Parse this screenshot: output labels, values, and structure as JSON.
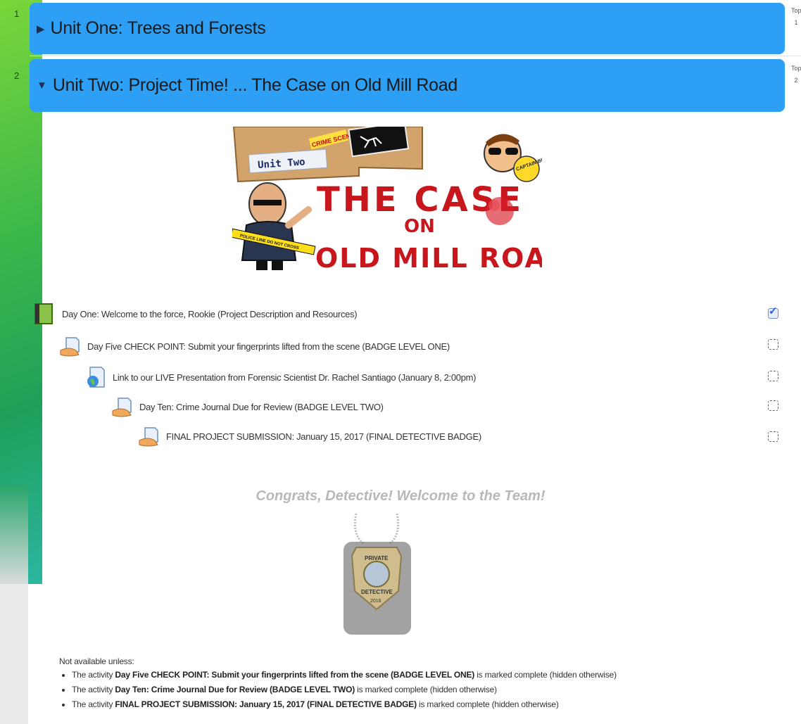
{
  "sections": [
    {
      "number": "1",
      "title": "Unit One: Trees and Forests",
      "expanded": false,
      "topic_label": "Top",
      "topic_num": "1"
    },
    {
      "number": "2",
      "title": "Unit Two: Project Time! ... The Case on Old Mill Road",
      "expanded": true,
      "topic_label": "Top",
      "topic_num": "2"
    }
  ],
  "banner": {
    "unit_label": "Unit Two",
    "crime_label": "CRIME SCENE",
    "title_line1": "THE CASE",
    "title_line2": "ON",
    "title_line3": "OLD MILL ROAD",
    "captain_label": "CAPTAIN BIGGS",
    "tape_label": "POLICE LINE DO NOT CROSS"
  },
  "activities": [
    {
      "label": "Day One: Welcome to the force, Rookie (Project Description and Resources)",
      "icon": "book-icon",
      "completed": true
    },
    {
      "label": "Day Five CHECK POINT: Submit your fingerprints lifted from the scene (BADGE LEVEL ONE)",
      "icon": "assignment-icon",
      "completed": false
    },
    {
      "label": "Link to our LIVE Presentation from Forensic Scientist Dr. Rachel Santiago (January 8, 2:00pm)",
      "icon": "url-globe-icon",
      "completed": false
    },
    {
      "label": "Day Ten: Crime Journal Due for Review (BADGE LEVEL TWO)",
      "icon": "assignment-icon",
      "completed": false
    },
    {
      "label": "FINAL PROJECT SUBMISSION: January 15, 2017 (FINAL DETECTIVE BADGE)",
      "icon": "assignment-icon",
      "completed": false
    }
  ],
  "congrats": "Congrats, Detective! Welcome to the Team!",
  "badge": {
    "top_text": "PRIVATE",
    "bottom_text": "DETECTIVE",
    "id_text": "2016"
  },
  "restriction": {
    "heading": "Not available unless:",
    "items": [
      {
        "prefix": "The activity ",
        "name": "Day Five CHECK POINT: Submit your fingerprints lifted from the scene (BADGE LEVEL ONE)",
        "suffix": " is marked complete (hidden otherwise)"
      },
      {
        "prefix": "The activity ",
        "name": "Day Ten: Crime Journal Due for Review (BADGE LEVEL TWO)",
        "suffix": " is marked complete (hidden otherwise)"
      },
      {
        "prefix": "The activity ",
        "name": "FINAL PROJECT SUBMISSION: January 15, 2017 (FINAL DETECTIVE BADGE)",
        "suffix": " is marked complete (hidden otherwise)"
      }
    ]
  },
  "colors": {
    "section_bar": "#2d9ff5",
    "accent_green": "#3cb84a",
    "banner_red": "#c8161d"
  }
}
